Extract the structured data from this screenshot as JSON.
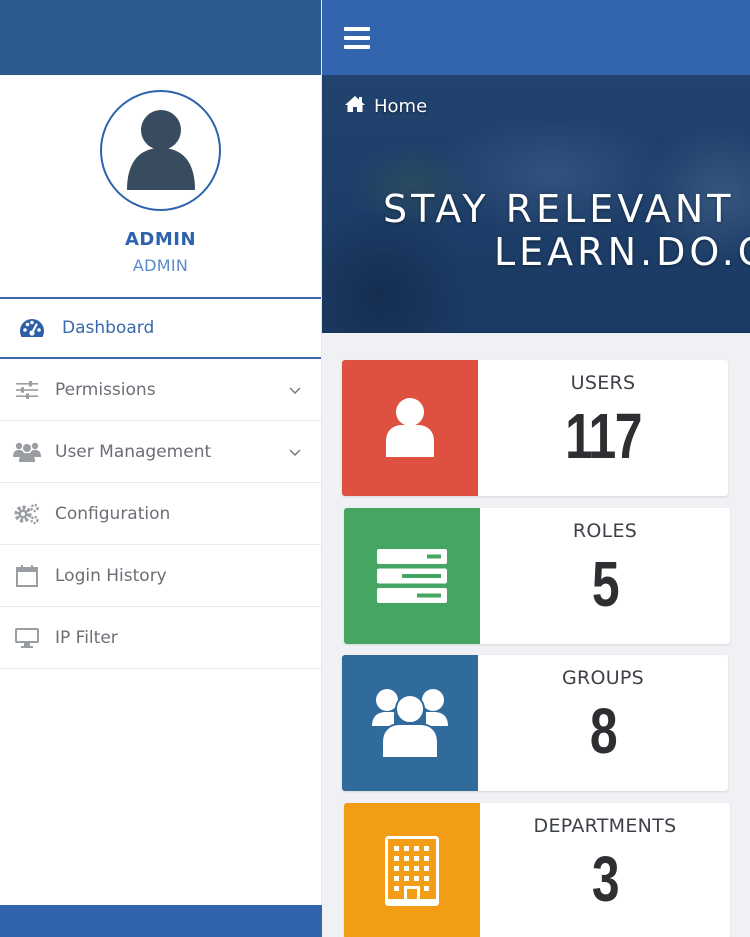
{
  "sidebar": {
    "user": {
      "name": "ADMIN",
      "role": "ADMIN"
    },
    "items": [
      {
        "label": "Dashboard",
        "icon": "dashboard-gauge-icon",
        "active": true,
        "expandable": false
      },
      {
        "label": "Permissions",
        "icon": "sliders-icon",
        "active": false,
        "expandable": true
      },
      {
        "label": "User Management",
        "icon": "users-icon",
        "active": false,
        "expandable": true
      },
      {
        "label": "Configuration",
        "icon": "gears-icon",
        "active": false,
        "expandable": false
      },
      {
        "label": "Login History",
        "icon": "calendar-icon",
        "active": false,
        "expandable": false
      },
      {
        "label": "IP Filter",
        "icon": "monitor-icon",
        "active": false,
        "expandable": false
      }
    ]
  },
  "header": {
    "menu_icon": "hamburger-icon"
  },
  "banner": {
    "breadcrumb": "Home",
    "line1": "STAY RELEVANT",
    "line2": "LEARN.DO.C"
  },
  "stats": [
    {
      "label": "USERS",
      "value": "117",
      "icon": "user-icon",
      "color": "#de5040"
    },
    {
      "label": "ROLES",
      "value": "5",
      "icon": "server-list-icon",
      "color": "#45a562"
    },
    {
      "label": "GROUPS",
      "value": "8",
      "icon": "group-icon",
      "color": "#316b9c"
    },
    {
      "label": "DEPARTMENTS",
      "value": "3",
      "icon": "building-icon",
      "color": "#f39c16"
    }
  ],
  "colors": {
    "primary": "#3265ae",
    "sidebar_header": "#2c5a8e",
    "active_text": "#3a68ad"
  }
}
